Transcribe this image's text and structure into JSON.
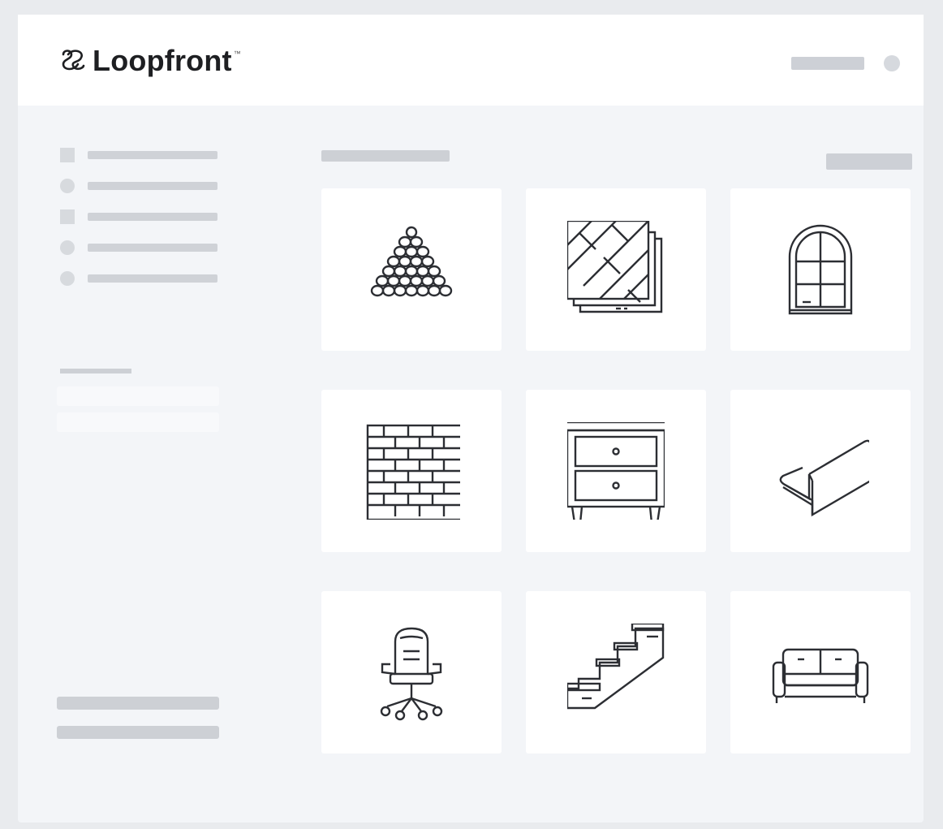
{
  "brand": {
    "name": "Loopfront",
    "trademark": "™",
    "logo_icon": "loop-logo-icon"
  },
  "header": {
    "account_icon": "circle-avatar-icon"
  },
  "sidebar": {
    "nav_icons": [
      "square-icon",
      "circle-icon",
      "square-icon",
      "circle-icon",
      "circle-icon"
    ]
  },
  "catalog": {
    "tiles": [
      {
        "icon": "gravel-pile-icon"
      },
      {
        "icon": "parquet-tiles-icon"
      },
      {
        "icon": "arched-window-icon"
      },
      {
        "icon": "brick-wall-icon"
      },
      {
        "icon": "nightstand-icon"
      },
      {
        "icon": "l-wall-element-icon"
      },
      {
        "icon": "office-chair-icon"
      },
      {
        "icon": "staircase-icon"
      },
      {
        "icon": "sofa-icon"
      }
    ]
  },
  "colors": {
    "line_icon": "#2c2e33",
    "placeholder": "#cdd0d5",
    "panel_bg": "#f3f5f8",
    "tile_bg": "#ffffff"
  }
}
